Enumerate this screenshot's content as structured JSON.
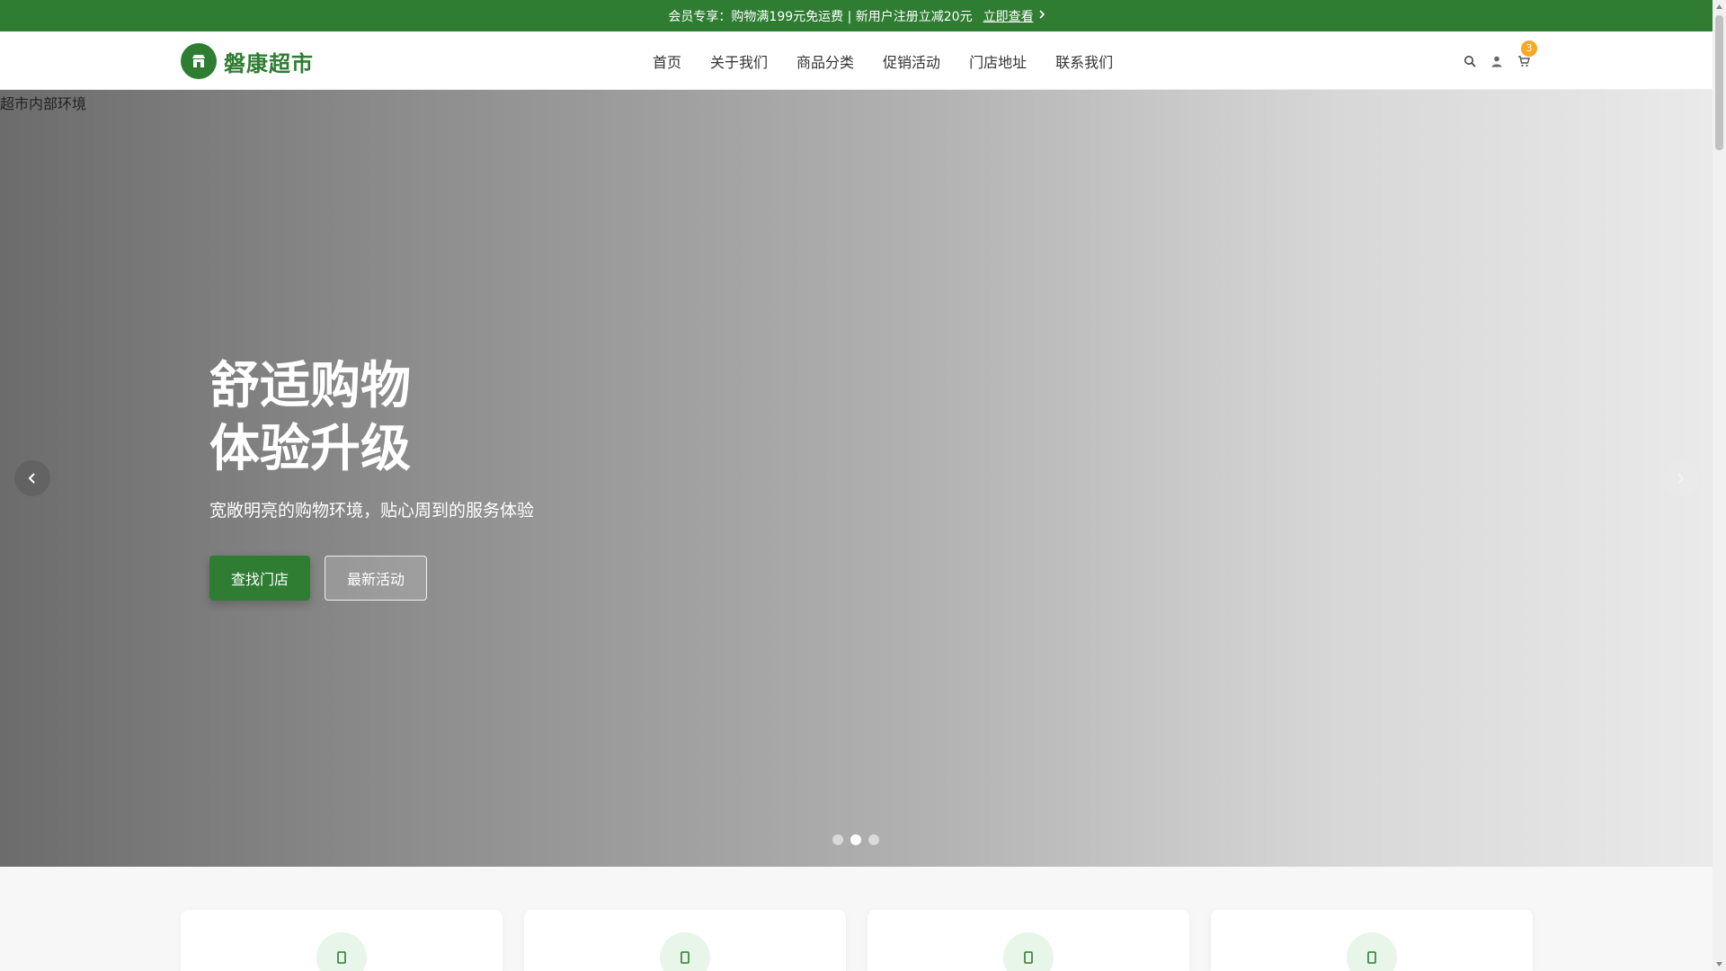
{
  "promo": {
    "text": "会员专享：购物满199元免运费 | 新用户注册立减20元",
    "link_label": "立即查看"
  },
  "header": {
    "logo_text": "磐康超市",
    "nav": [
      "首页",
      "关于我们",
      "商品分类",
      "促销活动",
      "门店地址",
      "联系我们"
    ],
    "cart_count": "3",
    "icons": [
      "search-icon",
      "user-icon",
      "cart-icon"
    ]
  },
  "hero": {
    "image_alt": "超市内部环境",
    "title_line1": "舒适购物",
    "title_line2": "体验升级",
    "subtitle": "宽敞明亮的购物环境，贴心周到的服务体验",
    "primary_button": "查找门店",
    "secondary_button": "最新活动",
    "slides_total": 3,
    "active_slide": 2
  },
  "features": {
    "card_count": 4
  },
  "colors": {
    "brand_green": "#2e7d32",
    "badge_orange": "#f9a825",
    "feature_icon_bg": "#e8f5e9"
  }
}
